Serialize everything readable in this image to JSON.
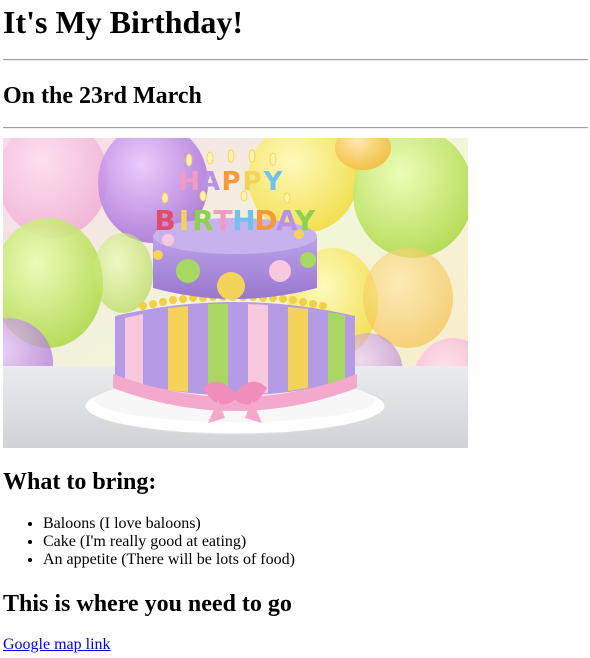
{
  "page": {
    "title": "It's My Birthday!",
    "date_heading": "On the 23rd March",
    "image": {
      "alt": "Birthday cake with Happy Birthday candles",
      "candle_words": [
        "HAPPY",
        "BIRTHDAY"
      ]
    },
    "bring_heading": "What to bring:",
    "bring_items": [
      "Baloons (I love baloons)",
      "Cake (I'm really good at eating)",
      "An appetite (There will be lots of food)"
    ],
    "go_heading": "This is where you need to go",
    "map_link_label": "Google map link"
  },
  "colors": {
    "link": "#0000ee",
    "rule": "#a0a0a0"
  }
}
